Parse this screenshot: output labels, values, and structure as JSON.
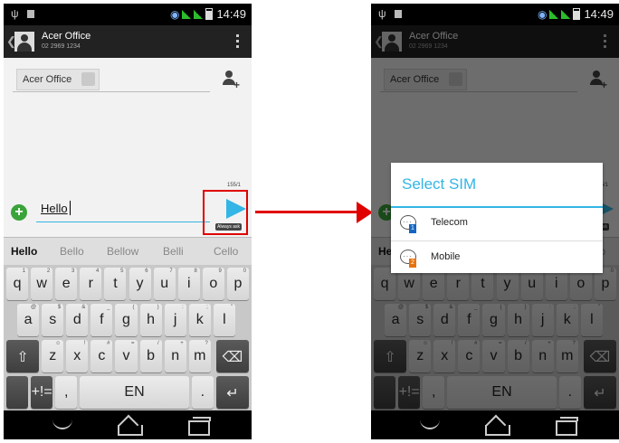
{
  "status": {
    "time": "14:49",
    "usb_icon": "usb-icon"
  },
  "contact": {
    "name": "Acer Office",
    "number": "02 2969 1234",
    "chip_label": "Acer Office"
  },
  "message": {
    "text": "Hello",
    "counter": "155/1",
    "send_hint": "Always ask"
  },
  "suggestions": [
    "Hello",
    "Bello",
    "Bellow",
    "Belli",
    "Cello"
  ],
  "keyboard": {
    "row1": [
      {
        "k": "q",
        "s": "1"
      },
      {
        "k": "w",
        "s": "2"
      },
      {
        "k": "e",
        "s": "3"
      },
      {
        "k": "r",
        "s": "4"
      },
      {
        "k": "t",
        "s": "5"
      },
      {
        "k": "y",
        "s": "6"
      },
      {
        "k": "u",
        "s": "7"
      },
      {
        "k": "i",
        "s": "8"
      },
      {
        "k": "o",
        "s": "9"
      },
      {
        "k": "p",
        "s": "0"
      }
    ],
    "row2": [
      {
        "k": "a",
        "s": "@"
      },
      {
        "k": "s",
        "s": "$"
      },
      {
        "k": "d",
        "s": "&"
      },
      {
        "k": "f",
        "s": "_"
      },
      {
        "k": "g",
        "s": "("
      },
      {
        "k": "h",
        "s": ")"
      },
      {
        "k": "j",
        "s": ":"
      },
      {
        "k": "k",
        "s": ";"
      },
      {
        "k": "l",
        "s": "\""
      }
    ],
    "row3": [
      {
        "k": "z",
        "s": "☺"
      },
      {
        "k": "x",
        "s": "!"
      },
      {
        "k": "c",
        "s": "#"
      },
      {
        "k": "v",
        "s": "="
      },
      {
        "k": "b",
        "s": "/"
      },
      {
        "k": "n",
        "s": "+"
      },
      {
        "k": "m",
        "s": "?"
      }
    ],
    "shift": "⇧",
    "delete": "⌫",
    "symbols": "+!=",
    "comma": ",",
    "space_label": "EN",
    "period": ".",
    "enter": "↵"
  },
  "dialog": {
    "title": "Select SIM",
    "options": [
      {
        "label": "Telecom",
        "badge": "1",
        "color": "#1565c0"
      },
      {
        "label": "Mobile",
        "badge": "2",
        "color": "#e8710a"
      }
    ]
  },
  "colors": {
    "accent": "#33b5e5",
    "highlight": "#e00000",
    "plus": "#3aa33a"
  }
}
